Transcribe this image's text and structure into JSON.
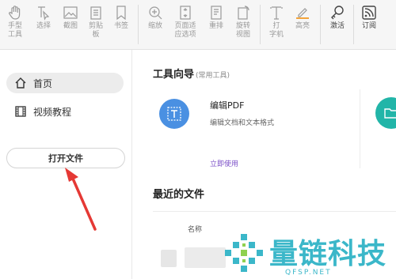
{
  "toolbar": {
    "items": [
      {
        "label": "手型\n工具",
        "icon": "hand-icon"
      },
      {
        "label": "选择",
        "icon": "select-cursor-icon"
      },
      {
        "label": "截图",
        "icon": "screenshot-icon"
      },
      {
        "label": "剪贴\n板",
        "icon": "clipboard-icon"
      },
      {
        "label": "书签",
        "icon": "bookmark-icon"
      },
      {
        "label": "缩放",
        "icon": "zoom-icon"
      },
      {
        "label": "页面适\n应选项",
        "icon": "fit-page-icon"
      },
      {
        "label": "重排",
        "icon": "reflow-icon"
      },
      {
        "label": "旋转\n视图",
        "icon": "rotate-view-icon"
      },
      {
        "label": "打\n字机",
        "icon": "typewriter-icon"
      },
      {
        "label": "高亮",
        "icon": "highlight-icon"
      },
      {
        "label": "激活",
        "icon": "activate-key-icon"
      },
      {
        "label": "订阅",
        "icon": "subscribe-icon"
      }
    ]
  },
  "sidebar": {
    "items": [
      {
        "label": "首页",
        "icon": "home-icon",
        "selected": true
      },
      {
        "label": "视频教程",
        "icon": "video-icon",
        "selected": false
      }
    ],
    "open_file": "打开文件"
  },
  "main": {
    "tools_title": "工具向导",
    "tools_sub": "(常用工具)",
    "tool": {
      "name": "编辑PDF",
      "desc": "编辑文档和文本格式",
      "link": "立即使用",
      "icon": "edit-text-icon"
    },
    "recent_title": "最近的文件",
    "column_name": "名称"
  },
  "watermark": {
    "text": "量链科技",
    "url": "QFSP.NET"
  },
  "colors": {
    "accent": "#4a90e2",
    "link": "#7b4fc7",
    "watermark": "#3bb7c9",
    "arrow": "#e53935"
  }
}
